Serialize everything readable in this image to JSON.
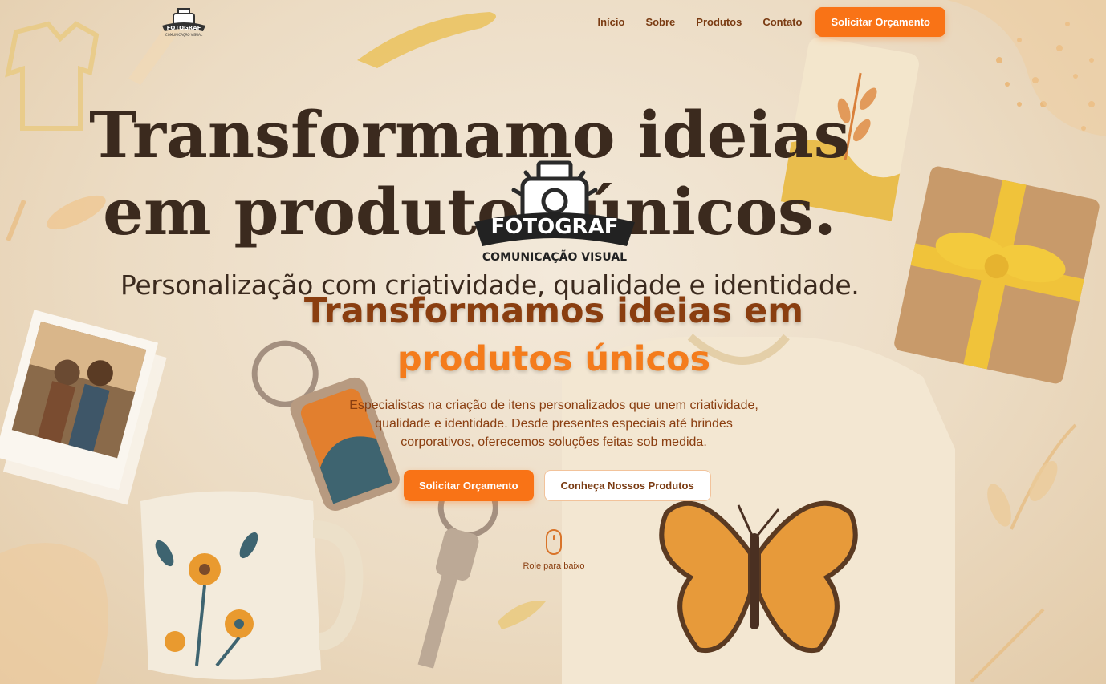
{
  "brand": {
    "logo_text": "FOTOGRAF",
    "logo_tagline": "COMUNICAÇÃO VISUAL"
  },
  "nav": {
    "items": [
      {
        "label": "Início"
      },
      {
        "label": "Sobre"
      },
      {
        "label": "Produtos"
      },
      {
        "label": "Contato"
      }
    ],
    "cta_label": "Solicitar Orçamento"
  },
  "background_art": {
    "headline_line1": "Transformamo ideias",
    "headline_line2": "em produtos únicos.",
    "subheadline": "Personalização com criatividade, qualidade e identidade."
  },
  "hero": {
    "title_line1": "Transformamos ideias em",
    "title_line2": "produtos únicos",
    "description": "Especialistas na criação de itens personalizados que unem criatividade, qualidade e identidade. Desde presentes especiais até brindes corporativos, oferecemos soluções feitas sob medida.",
    "primary_cta": "Solicitar Orçamento",
    "secondary_cta": "Conheça Nossos Produtos",
    "scroll_hint": "Role para baixo"
  },
  "colors": {
    "accent": "#f97316",
    "text_brown": "#8a3e10",
    "background": "#ede0cc"
  }
}
